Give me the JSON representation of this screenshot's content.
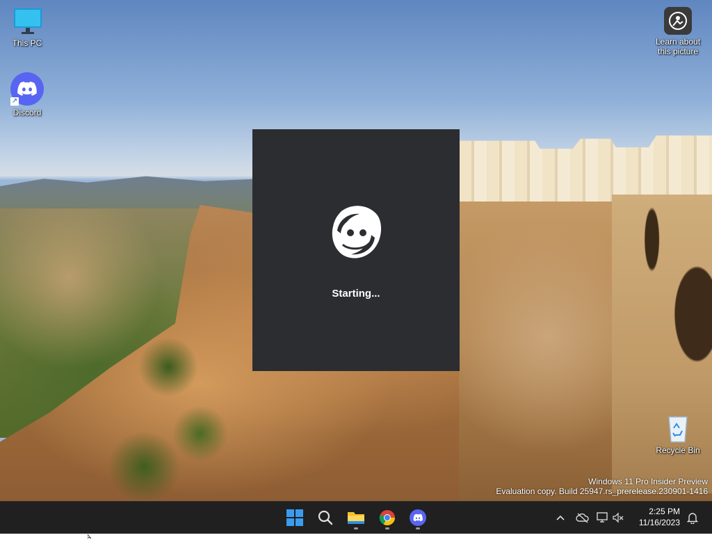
{
  "desktop": {
    "icons": [
      {
        "label": "This PC",
        "icon": "monitor-icon"
      },
      {
        "label": "Discord",
        "icon": "discord-icon"
      },
      {
        "label": "Learn about\nthis picture",
        "icon": "camera-info-icon"
      },
      {
        "label": "Recycle Bin",
        "icon": "recycle-bin-icon"
      }
    ],
    "watermark": {
      "line1": "Windows 11 Pro Insider Preview",
      "line2": "Evaluation copy. Build 25947.rs_prerelease.230901-1416"
    }
  },
  "splash": {
    "app": "Discord",
    "status": "Starting...",
    "background_color": "#2b2d31",
    "logo_icon": "discord-spinner-icon"
  },
  "taskbar": {
    "apps": [
      {
        "name": "Start",
        "icon": "windows-start-icon",
        "running": false
      },
      {
        "name": "Search",
        "icon": "search-icon",
        "running": false
      },
      {
        "name": "File Explorer",
        "icon": "folder-icon",
        "running": true
      },
      {
        "name": "Google Chrome",
        "icon": "chrome-icon",
        "running": true
      },
      {
        "name": "Discord",
        "icon": "discord-icon",
        "running": true
      }
    ],
    "tray": {
      "time": "2:25 PM",
      "date": "11/16/2023",
      "icons": [
        "chevron-up-icon",
        "onedrive-icon",
        "network-icon",
        "volume-mute-icon",
        "notification-bell-icon"
      ]
    }
  },
  "colors": {
    "taskbar_bg": "#202020",
    "discord_blurple": "#5865f2",
    "start_blue": "#3a9cf0"
  }
}
